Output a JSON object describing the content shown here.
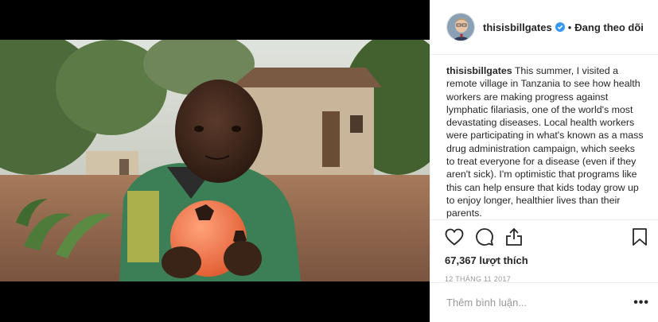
{
  "post": {
    "image_alt": "Child holding an orange ball in a village"
  },
  "header": {
    "username": "thisisbillgates",
    "separator": "•",
    "follow_status": "Đang theo dõi"
  },
  "caption": {
    "username": "thisisbillgates",
    "text": "This summer, I visited a remote village in Tanzania to see how health workers are making progress against lymphatic filariasis, one of the world's most devastating diseases. Local health workers were participating in what's known as a mass drug administration campaign, which seeks to treat everyone for a disease (even if they aren't sick). I'm optimistic that programs like this can help ensure that kids today grow up to enjoy longer, healthier lives than their parents."
  },
  "actions": {
    "likes": "67,367 lượt thích",
    "date": "12 THÁNG 11 2017"
  },
  "comment": {
    "placeholder": "Thêm bình luận...",
    "more": "•••"
  },
  "colors": {
    "verified": "#3897f0",
    "border": "#efefef",
    "muted": "#999999"
  }
}
